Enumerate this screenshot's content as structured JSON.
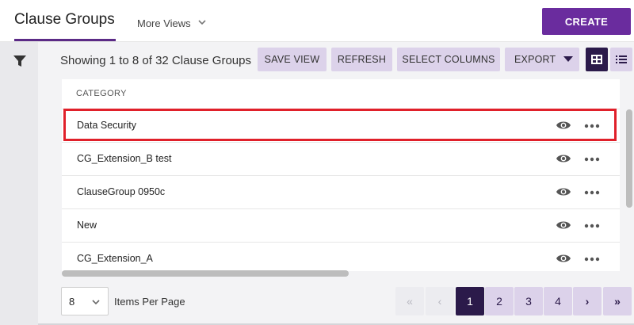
{
  "header": {
    "tab_title": "Clause Groups",
    "more_views_label": "More Views",
    "create_label": "CREATE"
  },
  "toolbar": {
    "showing_text": "Showing 1 to 8 of 32 Clause Groups",
    "save_view_label": "SAVE VIEW",
    "refresh_label": "REFRESH",
    "select_columns_label": "SELECT COLUMNS",
    "export_label": "EXPORT"
  },
  "table": {
    "column_header": "CATEGORY",
    "rows": [
      {
        "label": "Data Security"
      },
      {
        "label": "CG_Extension_B test"
      },
      {
        "label": "ClauseGroup 0950c"
      },
      {
        "label": "New"
      },
      {
        "label": "CG_Extension_A"
      }
    ]
  },
  "footer": {
    "per_page_value": "8",
    "per_page_label": "Items Per Page",
    "pages": [
      "1",
      "2",
      "3",
      "4"
    ],
    "active_page": "1",
    "first_glyph": "«",
    "prev_glyph": "‹",
    "next_glyph": "›",
    "last_glyph": "»"
  },
  "colors": {
    "accent": "#6a2c9e",
    "dark_accent": "#2b1a4a",
    "light_accent": "#dcd2ea",
    "highlight": "#e0202a"
  },
  "icons": {
    "filter": "filter-icon",
    "view_grid": "grid-view-icon",
    "view_list": "list-view-icon",
    "row_view": "eye-icon",
    "row_more": "more-horizontal-icon"
  }
}
